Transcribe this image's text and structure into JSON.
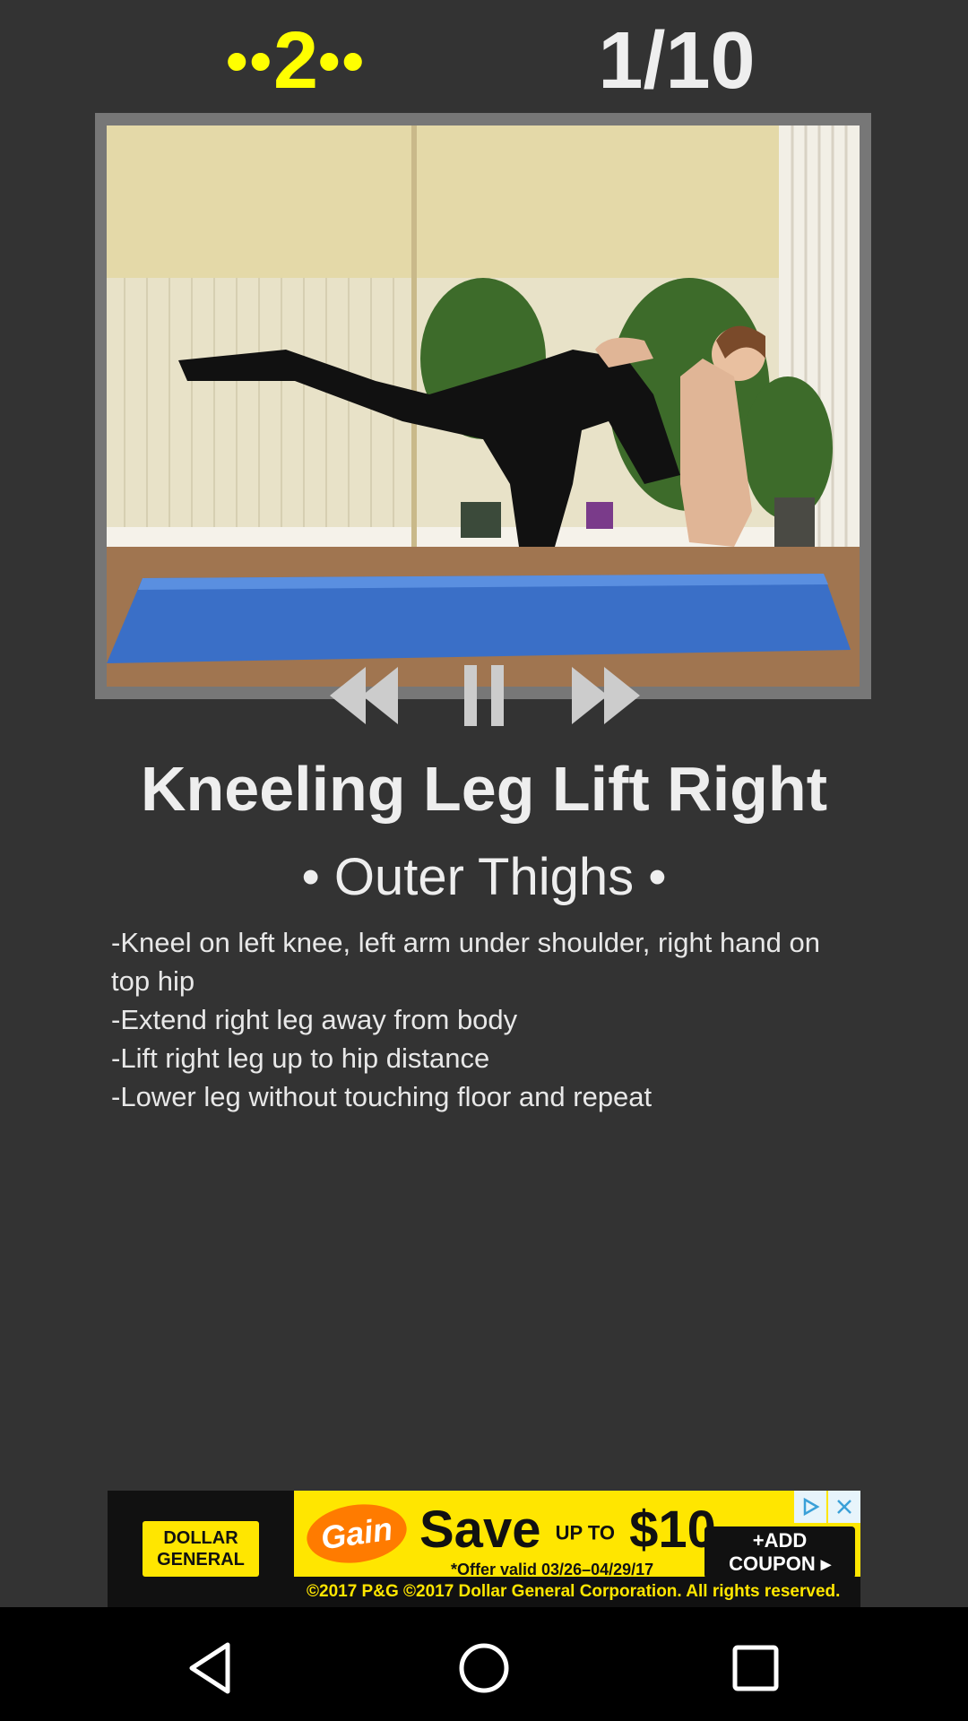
{
  "header": {
    "round_dots_left": "••",
    "round_number": "2",
    "round_dots_right": "••",
    "progress": "1/10",
    "round_color": "#ffff00"
  },
  "video": {
    "description_icon": "exercise-video-icon"
  },
  "controls": {
    "rewind_icon": "rewind-icon",
    "pause_icon": "pause-icon",
    "forward_icon": "fast-forward-icon"
  },
  "exercise": {
    "title": "Kneeling Leg Lift Right",
    "target": "• Outer Thighs •",
    "instructions": [
      "-Kneel on left knee, left arm under shoulder, right hand on top hip",
      "-Extend right leg away from body",
      "-Lift right leg up to hip distance",
      "-Lower leg without touching floor and repeat"
    ]
  },
  "ad": {
    "brand_line1": "DOLLAR",
    "brand_line2": "GENERAL",
    "product": "Gain",
    "save_text": "Save",
    "up_to": "UP TO",
    "amount": "$10",
    "fine_print": "*Offer valid 03/26–04/29/17",
    "coupon_line1": "+ADD",
    "coupon_line2": "COUPON ▸",
    "copyright": "©2017 P&G ©2017 Dollar General Corporation. All rights reserved."
  },
  "navbar": {
    "back_icon": "back-icon",
    "home_icon": "home-icon",
    "recents_icon": "recents-icon"
  }
}
